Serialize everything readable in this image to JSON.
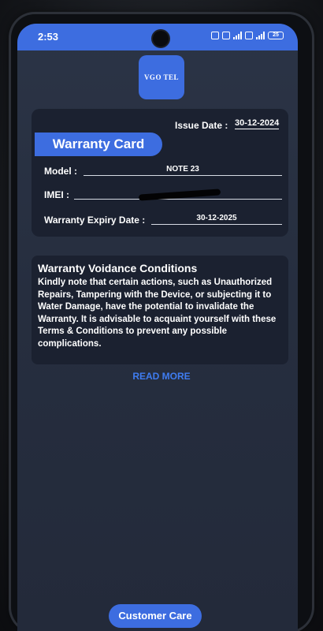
{
  "status_bar": {
    "time": "2:53",
    "battery": "25"
  },
  "header": {
    "logo_text": "VGO TEL"
  },
  "warranty_card": {
    "issue_date_label": "Issue Date :",
    "issue_date_value": "30-12-2024",
    "title": "Warranty Card",
    "model_label": "Model :",
    "model_value": "NOTE 23",
    "imei_label": "IMEI :",
    "imei_value": "",
    "expiry_label": "Warranty Expiry Date :",
    "expiry_value": "30-12-2025"
  },
  "conditions": {
    "title": "Warranty Voidance Conditions",
    "body": "Kindly note that certain actions, such as Unauthorized Repairs, Tampering with the Device, or subjecting it to Water Damage, have the potential to invalidate the Warranty. It is advisable to acquaint yourself with these Terms & Conditions to prevent any possible complications."
  },
  "actions": {
    "read_more_label": "READ MORE",
    "customer_care_label": "Customer Care"
  },
  "colors": {
    "accent": "#3d6de0",
    "link": "#3f7cf0",
    "card_bg": "#1b2130",
    "screen_bg": "#262e3f"
  }
}
